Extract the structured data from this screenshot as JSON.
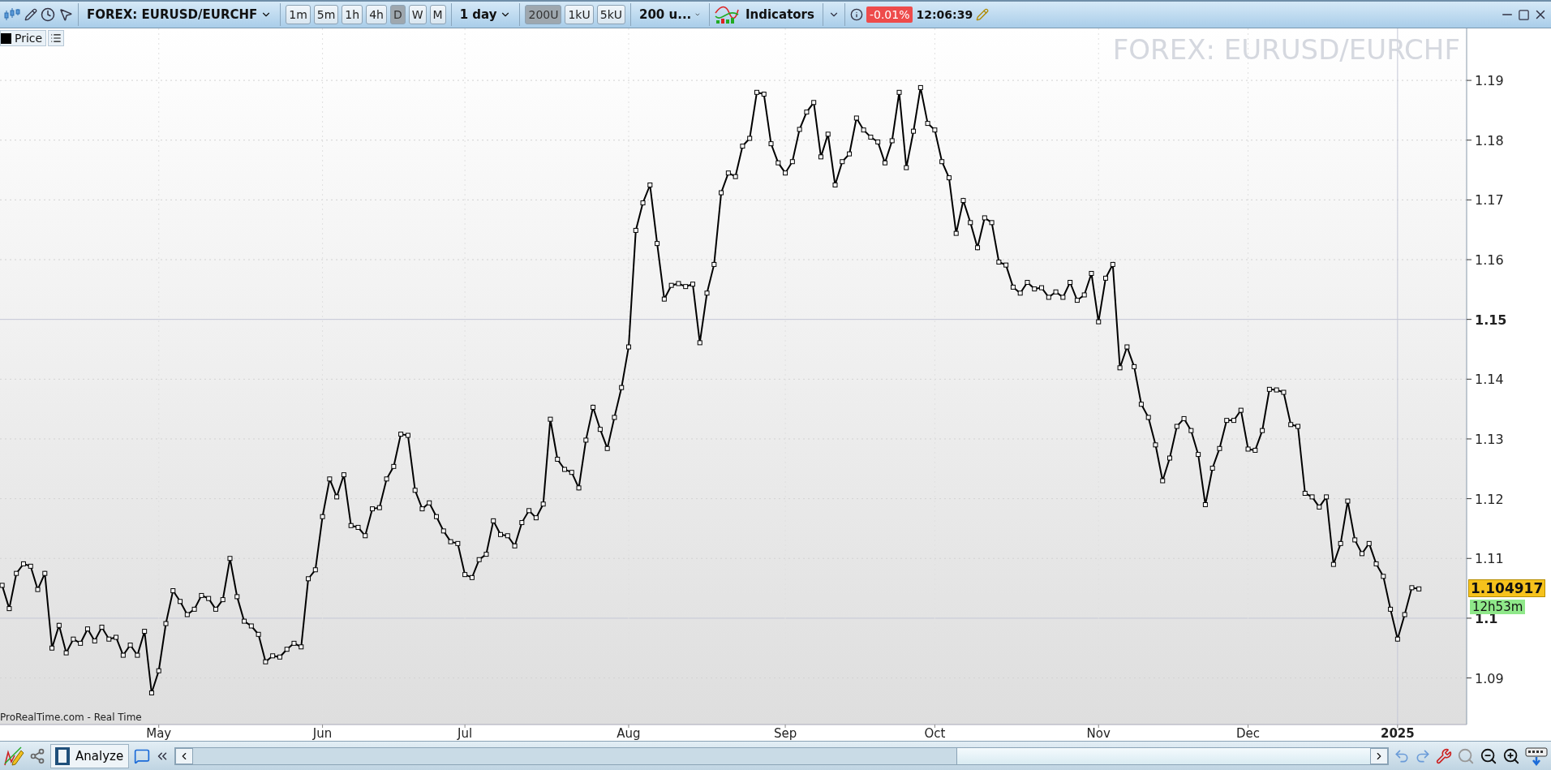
{
  "toolbar": {
    "instrument": "FOREX: EURUSD/EURCHF",
    "periods": [
      {
        "label": "1m",
        "selected": false
      },
      {
        "label": "5m",
        "selected": false
      },
      {
        "label": "1h",
        "selected": false
      },
      {
        "label": "4h",
        "selected": false
      },
      {
        "label": "D",
        "selected": true
      },
      {
        "label": "W",
        "selected": false
      },
      {
        "label": "M",
        "selected": false
      }
    ],
    "timeframe": "1 day",
    "units": [
      {
        "label": "200U",
        "selected": true
      },
      {
        "label": "1kU",
        "selected": false
      },
      {
        "label": "5kU",
        "selected": false
      }
    ],
    "units_menu": "200 u...",
    "indicators": "Indicators",
    "change": "-0.01%",
    "time": "12:06:39"
  },
  "chart": {
    "source": "ProRealTime.com - Real Time",
    "last_price": "1.104917",
    "countdown": "12h53m",
    "chart_data": {
      "type": "line",
      "title": "FOREX: EURUSD/EURCHF",
      "grid": true,
      "categories": [
        null,
        null,
        null,
        null,
        null,
        null,
        null,
        null,
        null,
        null,
        null,
        null,
        null,
        null,
        null,
        null,
        null,
        null,
        null,
        null,
        null,
        null,
        "May",
        null,
        null,
        null,
        null,
        null,
        null,
        null,
        null,
        null,
        null,
        null,
        null,
        null,
        null,
        null,
        null,
        null,
        null,
        null,
        null,
        null,
        null,
        "Jun",
        null,
        null,
        null,
        null,
        null,
        null,
        null,
        null,
        null,
        null,
        null,
        null,
        null,
        null,
        null,
        null,
        null,
        null,
        null,
        "Jul",
        null,
        null,
        null,
        null,
        null,
        null,
        null,
        null,
        null,
        null,
        null,
        null,
        null,
        null,
        null,
        null,
        null,
        null,
        null,
        null,
        null,
        null,
        "Aug",
        null,
        null,
        null,
        null,
        null,
        null,
        null,
        null,
        null,
        null,
        null,
        null,
        null,
        null,
        null,
        null,
        null,
        null,
        null,
        null,
        null,
        "Sep",
        null,
        null,
        null,
        null,
        null,
        null,
        null,
        null,
        null,
        null,
        null,
        null,
        null,
        null,
        null,
        null,
        null,
        null,
        null,
        null,
        "Oct",
        null,
        null,
        null,
        null,
        null,
        null,
        null,
        null,
        null,
        null,
        null,
        null,
        null,
        null,
        null,
        null,
        null,
        null,
        null,
        null,
        null,
        null,
        "Nov",
        null,
        null,
        null,
        null,
        null,
        null,
        null,
        null,
        null,
        null,
        null,
        null,
        null,
        null,
        null,
        null,
        null,
        null,
        null,
        null,
        "Dec",
        null,
        null,
        null,
        null,
        null,
        null,
        null,
        null,
        null,
        null,
        null,
        null,
        null,
        null,
        null,
        null,
        null,
        null,
        null,
        null,
        "2025",
        null,
        null,
        null
      ],
      "series": [
        {
          "name": "Price",
          "color": "#000000",
          "marker": "square",
          "values": [
            1.1055,
            1.1016,
            1.1075,
            1.1091,
            1.1087,
            1.1048,
            1.1075,
            1.095,
            1.0988,
            1.0942,
            1.0965,
            1.0958,
            1.0982,
            1.0962,
            1.0985,
            1.0965,
            1.0968,
            1.0938,
            1.0955,
            1.0938,
            1.0978,
            1.0875,
            1.0912,
            1.0991,
            1.1046,
            1.1028,
            1.1006,
            1.1015,
            1.1038,
            1.1033,
            1.1015,
            1.1031,
            1.11,
            1.1036,
            1.0995,
            1.0987,
            1.0973,
            1.0927,
            1.0937,
            1.0935,
            1.0948,
            1.0958,
            1.0952,
            1.1066,
            1.1081,
            1.117,
            1.1233,
            1.1203,
            1.124,
            1.1155,
            1.1152,
            1.1138,
            1.1183,
            1.1185,
            1.1233,
            1.1254,
            1.1308,
            1.1306,
            1.1214,
            1.1183,
            1.1193,
            1.117,
            1.1146,
            1.1128,
            1.1125,
            1.1073,
            1.1068,
            1.1098,
            1.1107,
            1.1163,
            1.114,
            1.1138,
            1.1121,
            1.116,
            1.118,
            1.1168,
            1.1191,
            1.1333,
            1.1266,
            1.1249,
            1.1244,
            1.1218,
            1.1298,
            1.1353,
            1.1316,
            1.1284,
            1.1336,
            1.1386,
            1.1454,
            1.1649,
            1.1695,
            1.1725,
            1.1627,
            1.1534,
            1.1557,
            1.156,
            1.1555,
            1.1559,
            1.1461,
            1.1544,
            1.1592,
            1.1712,
            1.1745,
            1.1739,
            1.179,
            1.1803,
            1.188,
            1.1877,
            1.1794,
            1.1762,
            1.1745,
            1.1764,
            1.1818,
            1.1847,
            1.1863,
            1.1772,
            1.181,
            1.1725,
            1.1764,
            1.1777,
            1.1837,
            1.1817,
            1.1805,
            1.1797,
            1.1762,
            1.1799,
            1.188,
            1.1754,
            1.1815,
            1.1888,
            1.1828,
            1.1817,
            1.1764,
            1.1737,
            1.1644,
            1.1699,
            1.1662,
            1.162,
            1.167,
            1.1662,
            1.1596,
            1.1591,
            1.1554,
            1.1544,
            1.1562,
            1.1551,
            1.1553,
            1.1537,
            1.1546,
            1.1537,
            1.1562,
            1.1532,
            1.1541,
            1.1577,
            1.1496,
            1.1569,
            1.1592,
            1.1419,
            1.1454,
            1.1421,
            1.1358,
            1.1336,
            1.129,
            1.123,
            1.1268,
            1.1321,
            1.1334,
            1.1314,
            1.1274,
            1.119,
            1.1251,
            1.1284,
            1.1331,
            1.1331,
            1.1348,
            1.1283,
            1.1281,
            1.1314,
            1.1383,
            1.1382,
            1.1378,
            1.1324,
            1.1321,
            1.1209,
            1.1203,
            1.1186,
            1.1203,
            1.109,
            1.1125,
            1.1196,
            1.1131,
            1.1108,
            1.1125,
            1.1091,
            1.107,
            1.1015,
            1.0965,
            1.1006,
            1.1051,
            1.1049
          ]
        }
      ],
      "ylim": [
        1.0822,
        1.1987
      ],
      "yticks": [
        {
          "value": 1.09,
          "label": "1.09"
        },
        {
          "value": 1.1,
          "label": "1.1"
        },
        {
          "value": 1.11,
          "label": "1.11"
        },
        {
          "value": 1.12,
          "label": "1.12"
        },
        {
          "value": 1.13,
          "label": "1.13"
        },
        {
          "value": 1.14,
          "label": "1.14"
        },
        {
          "value": 1.15,
          "label": "1.15"
        },
        {
          "value": 1.16,
          "label": "1.16"
        },
        {
          "value": 1.17,
          "label": "1.17"
        },
        {
          "value": 1.18,
          "label": "1.18"
        },
        {
          "value": 1.19,
          "label": "1.19"
        }
      ]
    }
  },
  "bottom_bar": {
    "analyze": "Analyze"
  }
}
